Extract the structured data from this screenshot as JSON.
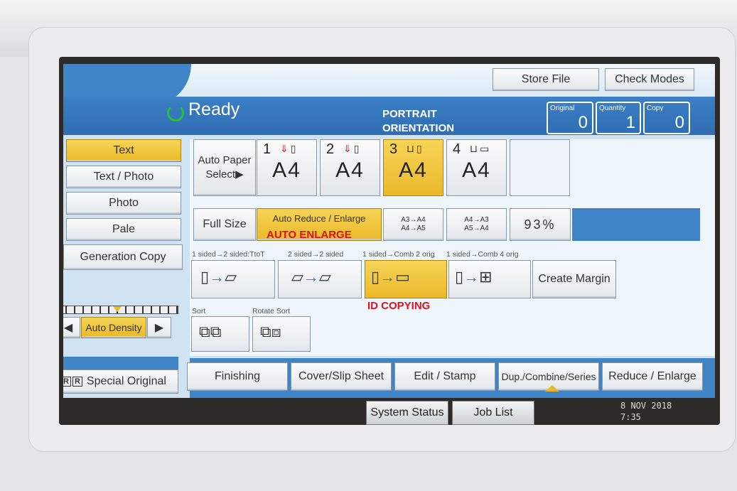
{
  "header": {
    "store_file": "Store File",
    "check_modes": "Check Modes",
    "status": "Ready"
  },
  "counters": [
    {
      "label": "Original",
      "value": "0"
    },
    {
      "label": "Quantity",
      "value": "1"
    },
    {
      "label": "Copy",
      "value": "0"
    }
  ],
  "overlays": {
    "portrait": "PORTRAIT",
    "orientation": "ORIENTATION",
    "auto_enlarge": "AUTO ENLARGE",
    "id_copying": "ID COPYING"
  },
  "original_types": [
    "Text",
    "Text / Photo",
    "Photo",
    "Pale",
    "Generation Copy"
  ],
  "paper": {
    "auto_line1": "Auto Paper",
    "auto_line2": "Select▶",
    "trays": [
      {
        "num": "1",
        "size": "A4"
      },
      {
        "num": "2",
        "size": "A4"
      },
      {
        "num": "3",
        "size": "A4"
      },
      {
        "num": "4",
        "size": "A4"
      }
    ]
  },
  "reduce": {
    "full_size": "Full Size",
    "auto_reduce": "Auto Reduce / Enlarge",
    "r1_line1": "A3→A4",
    "r1_line2": "A4→A5",
    "r2_line1": "A4→A3",
    "r2_line2": "A5→A4",
    "ratio": "93%"
  },
  "duplex": {
    "labels": [
      "1 sided→2 sided:TtoT",
      "2 sided→2 sided",
      "1 sided→Comb 2 orig",
      "1 sided→Comb 4 orig"
    ],
    "create_margin": "Create Margin"
  },
  "sort": {
    "sort_label": "Sort",
    "rotate_label": "Rotate Sort"
  },
  "density": {
    "label": "Auto Density"
  },
  "special_original": "Special Original",
  "tabs": [
    "Finishing",
    "Cover/Slip Sheet",
    "Edit / Stamp",
    "Dup./Combine/Series",
    "Reduce / Enlarge"
  ],
  "system": {
    "system_status": "System Status",
    "job_list": "Job List",
    "date": "8 NOV  2018",
    "time": "7:35"
  },
  "colors": {
    "selected": "#eab92a",
    "ready_bar": "#2f6db3",
    "overlay_red": "#d7141e"
  }
}
